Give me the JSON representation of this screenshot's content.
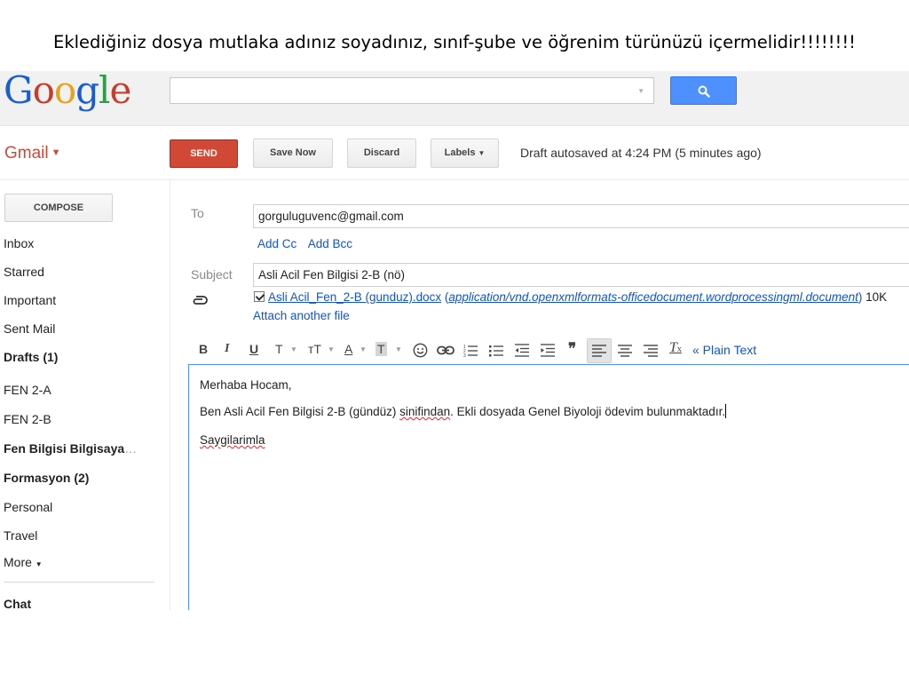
{
  "caption": "Eklediğiniz dosya mutlaka adınız soyadınız, sınıf-şube ve öğrenim türünüzü içermelidir!!!!!!!!",
  "header": {
    "logo": {
      "G": "G",
      "o1": "o",
      "o2": "o",
      "g": "g",
      "l": "l",
      "e": "e"
    },
    "search": {
      "value": "",
      "button_icon": "search-icon"
    }
  },
  "gmail_label": "Gmail",
  "toolbar": {
    "send": "SEND",
    "save_now": "Save Now",
    "discard": "Discard",
    "labels": "Labels",
    "autosave": "Draft autosaved at 4:24 PM (5 minutes ago)"
  },
  "sidebar": {
    "compose": "COMPOSE",
    "items": [
      {
        "label": "Inbox",
        "bold": false
      },
      {
        "label": "Starred",
        "bold": false
      },
      {
        "label": "Important",
        "bold": false
      },
      {
        "label": "Sent Mail",
        "bold": false
      },
      {
        "label": "Drafts (1)",
        "bold": true
      },
      {
        "label": "FEN 2-A",
        "bold": false
      },
      {
        "label": "FEN 2-B",
        "bold": false
      },
      {
        "label": "Fen Bilgisi Bilgisaya",
        "bold": true
      },
      {
        "label": "Formasyon (2)",
        "bold": true
      },
      {
        "label": "Personal",
        "bold": false
      },
      {
        "label": "Travel",
        "bold": false
      },
      {
        "label": "More",
        "bold": false
      }
    ],
    "chat": "Chat"
  },
  "compose": {
    "to_label": "To",
    "to_value": "gorguluguvenc@gmail.com",
    "add_cc": "Add Cc",
    "add_bcc": "Add Bcc",
    "subject_label": "Subject",
    "subject_value": "Asli Acil Fen Bilgisi 2-B (nö)",
    "attachment": {
      "checked": true,
      "name": "Asli Acil_Fen_2-B (gunduz).docx",
      "mime": "application/vnd.openxmlformats-officedocument.wordprocessingml.document",
      "size": "10K"
    },
    "attach_another": "Attach another file",
    "format_toolbar": {
      "bold": "B",
      "italic": "I",
      "underline": "U",
      "font": "T",
      "size": "тT",
      "text_color": "A",
      "bg_color": "T",
      "plain_text": "« Plain Text"
    },
    "body": {
      "greeting": "Merhaba Hocam,",
      "line1_a": "Ben Asli Acil Fen Bilgisi 2-B  (gündüz) ",
      "line1_b": "sinifindan",
      "line1_c": ". Ekli dosyada Genel Biyoloji ödevim bulunmaktadır.",
      "closing": "Saygilarimla"
    }
  }
}
